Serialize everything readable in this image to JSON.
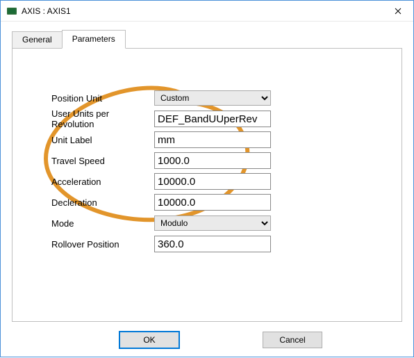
{
  "titlebar": {
    "title": "AXIS : AXIS1"
  },
  "tabs": {
    "general": "General",
    "parameters": "Parameters",
    "active": "parameters"
  },
  "fields": {
    "position_unit": {
      "label": "Position Unit",
      "value": "Custom"
    },
    "uupr": {
      "label": "User Units per Revolution",
      "value": "DEF_BandUUperRev"
    },
    "unit_label": {
      "label": "Unit Label",
      "value": "mm"
    },
    "travel_speed": {
      "label": "Travel Speed",
      "value": "1000.0"
    },
    "acceleration": {
      "label": "Acceleration",
      "value": "10000.0"
    },
    "decleration": {
      "label": "Decleration",
      "value": "10000.0"
    },
    "mode": {
      "label": "Mode",
      "value": "Modulo"
    },
    "rollover": {
      "label": "Rollover Position",
      "value": "360.0"
    }
  },
  "buttons": {
    "ok": "OK",
    "cancel": "Cancel"
  },
  "annotation": {
    "color": "#e2952b"
  }
}
